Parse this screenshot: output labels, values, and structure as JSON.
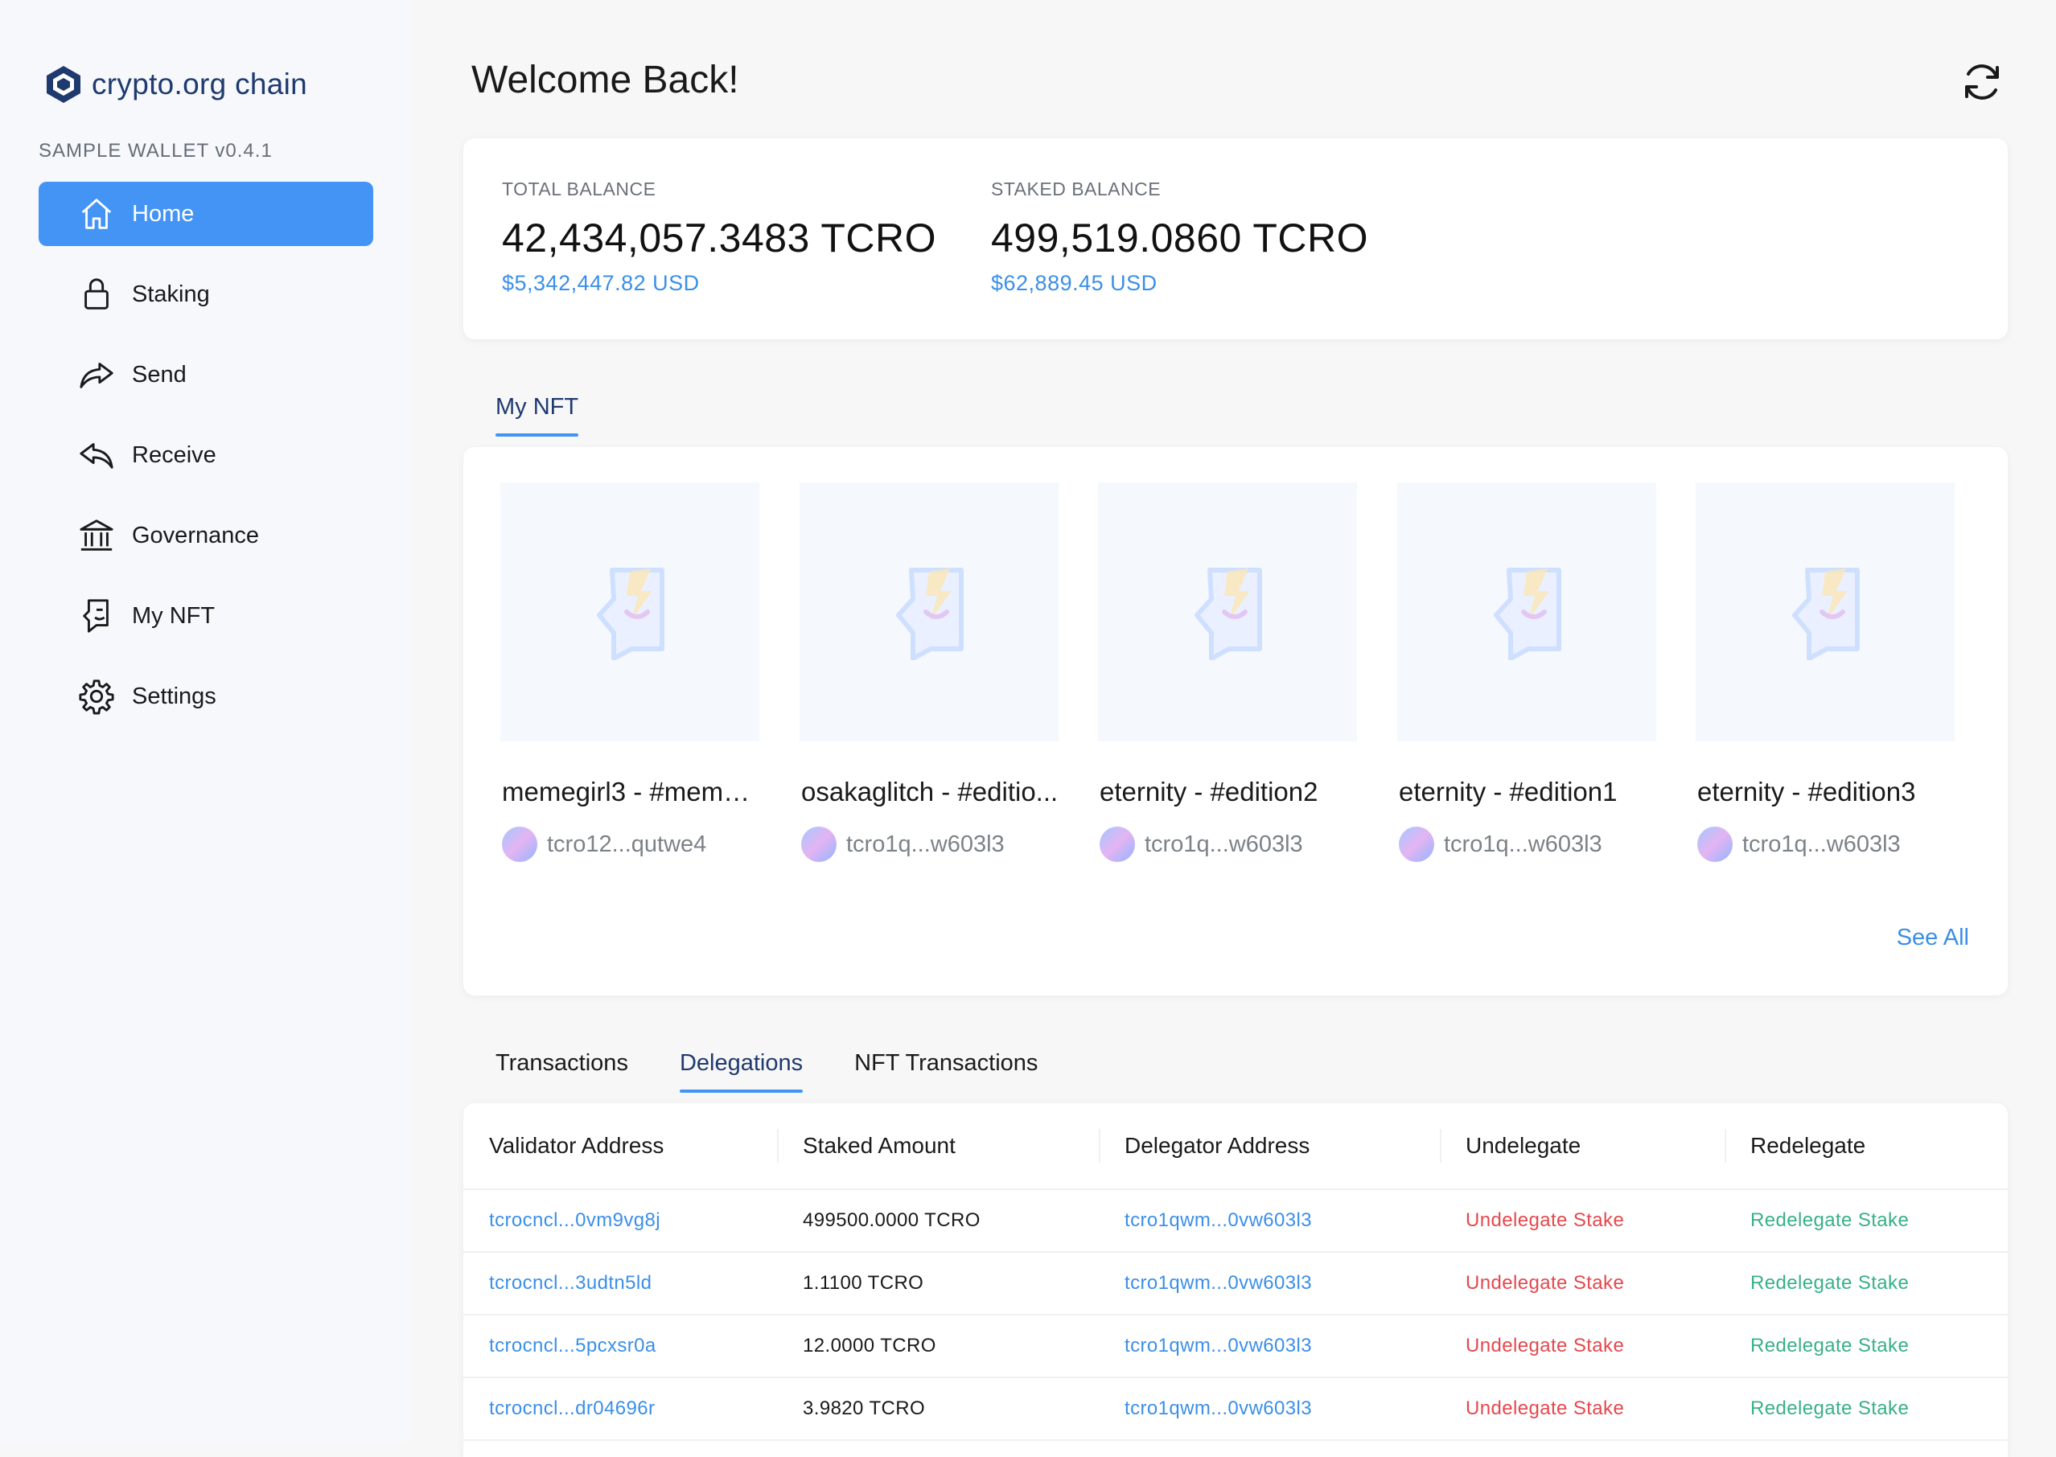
{
  "app": {
    "logo_text": "crypto.org chain",
    "version": "SAMPLE WALLET v0.4.1"
  },
  "sidebar": {
    "items": [
      {
        "label": "Home",
        "icon": "home-icon",
        "active": true
      },
      {
        "label": "Staking",
        "icon": "lock-icon"
      },
      {
        "label": "Send",
        "icon": "send-arrow-icon"
      },
      {
        "label": "Receive",
        "icon": "receive-arrow-icon"
      },
      {
        "label": "Governance",
        "icon": "bank-icon"
      },
      {
        "label": "My NFT",
        "icon": "nft-face-icon"
      },
      {
        "label": "Settings",
        "icon": "gear-icon"
      }
    ]
  },
  "header": {
    "title": "Welcome Back!",
    "refresh_icon": "refresh-icon"
  },
  "balance": {
    "total_label": "TOTAL BALANCE",
    "total_value": "42,434,057.3483 TCRO",
    "total_usd": "$5,342,447.82 USD",
    "staked_label": "STAKED BALANCE",
    "staked_value": "499,519.0860 TCRO",
    "staked_usd": "$62,889.45 USD"
  },
  "nft_section": {
    "tab_label": "My NFT",
    "items": [
      {
        "name": "memegirl3 - #meme...",
        "owner": "tcro12...qutwe4"
      },
      {
        "name": "osakaglitch - #editio...",
        "owner": "tcro1q...w603l3"
      },
      {
        "name": "eternity - #edition2",
        "owner": "tcro1q...w603l3"
      },
      {
        "name": "eternity - #edition1",
        "owner": "tcro1q...w603l3"
      },
      {
        "name": "eternity - #edition3",
        "owner": "tcro1q...w603l3"
      }
    ],
    "see_all": "See All"
  },
  "bottom_tabs": [
    "Transactions",
    "Delegations",
    "NFT Transactions"
  ],
  "active_bottom_tab": "Delegations",
  "delegations": {
    "headers": [
      "Validator Address",
      "Staked Amount",
      "Delegator Address",
      "Undelegate",
      "Redelegate"
    ],
    "rows": [
      {
        "validator": "tcrocncl...0vm9vg8j",
        "amount": "499500.0000 TCRO",
        "delegator": "tcro1qwm...0vw603l3",
        "undelegate": "Undelegate Stake",
        "redelegate": "Redelegate Stake"
      },
      {
        "validator": "tcrocncl...3udtn5ld",
        "amount": "1.1100 TCRO",
        "delegator": "tcro1qwm...0vw603l3",
        "undelegate": "Undelegate Stake",
        "redelegate": "Redelegate Stake"
      },
      {
        "validator": "tcrocncl...5pcxsr0a",
        "amount": "12.0000 TCRO",
        "delegator": "tcro1qwm...0vw603l3",
        "undelegate": "Undelegate Stake",
        "redelegate": "Redelegate Stake"
      },
      {
        "validator": "tcrocncl...dr04696r",
        "amount": "3.9820 TCRO",
        "delegator": "tcro1qwm...0vw603l3",
        "undelegate": "Undelegate Stake",
        "redelegate": "Redelegate Stake"
      }
    ]
  },
  "colors": {
    "accent": "#4394f5",
    "link": "#3b8fe8",
    "undelegate": "#e5484d",
    "redelegate": "#38b089",
    "brand": "#1f3a6e"
  }
}
